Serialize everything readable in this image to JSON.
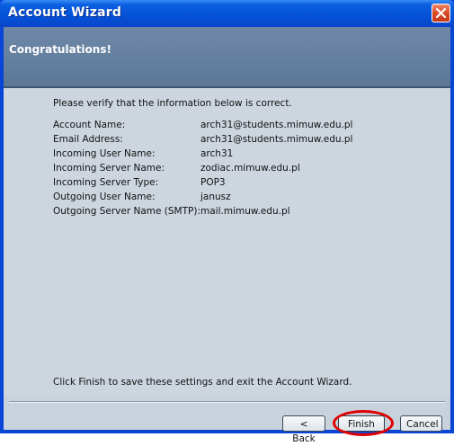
{
  "window": {
    "title": "Account Wizard"
  },
  "banner": {
    "title": "Congratulations!"
  },
  "content": {
    "verify_text": "Please verify that the information below is correct.",
    "fields": [
      {
        "label": "Account Name:",
        "value": "arch31@students.mimuw.edu.pl"
      },
      {
        "label": "Email Address:",
        "value": "arch31@students.mimuw.edu.pl"
      },
      {
        "label": "Incoming User Name:",
        "value": "arch31"
      },
      {
        "label": "Incoming Server Name:",
        "value": "zodiac.mimuw.edu.pl"
      },
      {
        "label": "Incoming Server Type:",
        "value": "POP3"
      },
      {
        "label": "Outgoing User Name:",
        "value": "janusz"
      },
      {
        "label": "Outgoing Server Name (SMTP):",
        "value": "mail.mimuw.edu.pl"
      }
    ],
    "finish_note": "Click Finish to save these settings and exit the Account Wizard."
  },
  "buttons": {
    "back": "< Back",
    "finish": "Finish",
    "cancel": "Cancel"
  },
  "icons": {
    "close": "close-icon"
  },
  "colors": {
    "title_bar": "#0552d8",
    "banner": "#6f88a8",
    "highlight_ring": "#e00000"
  }
}
